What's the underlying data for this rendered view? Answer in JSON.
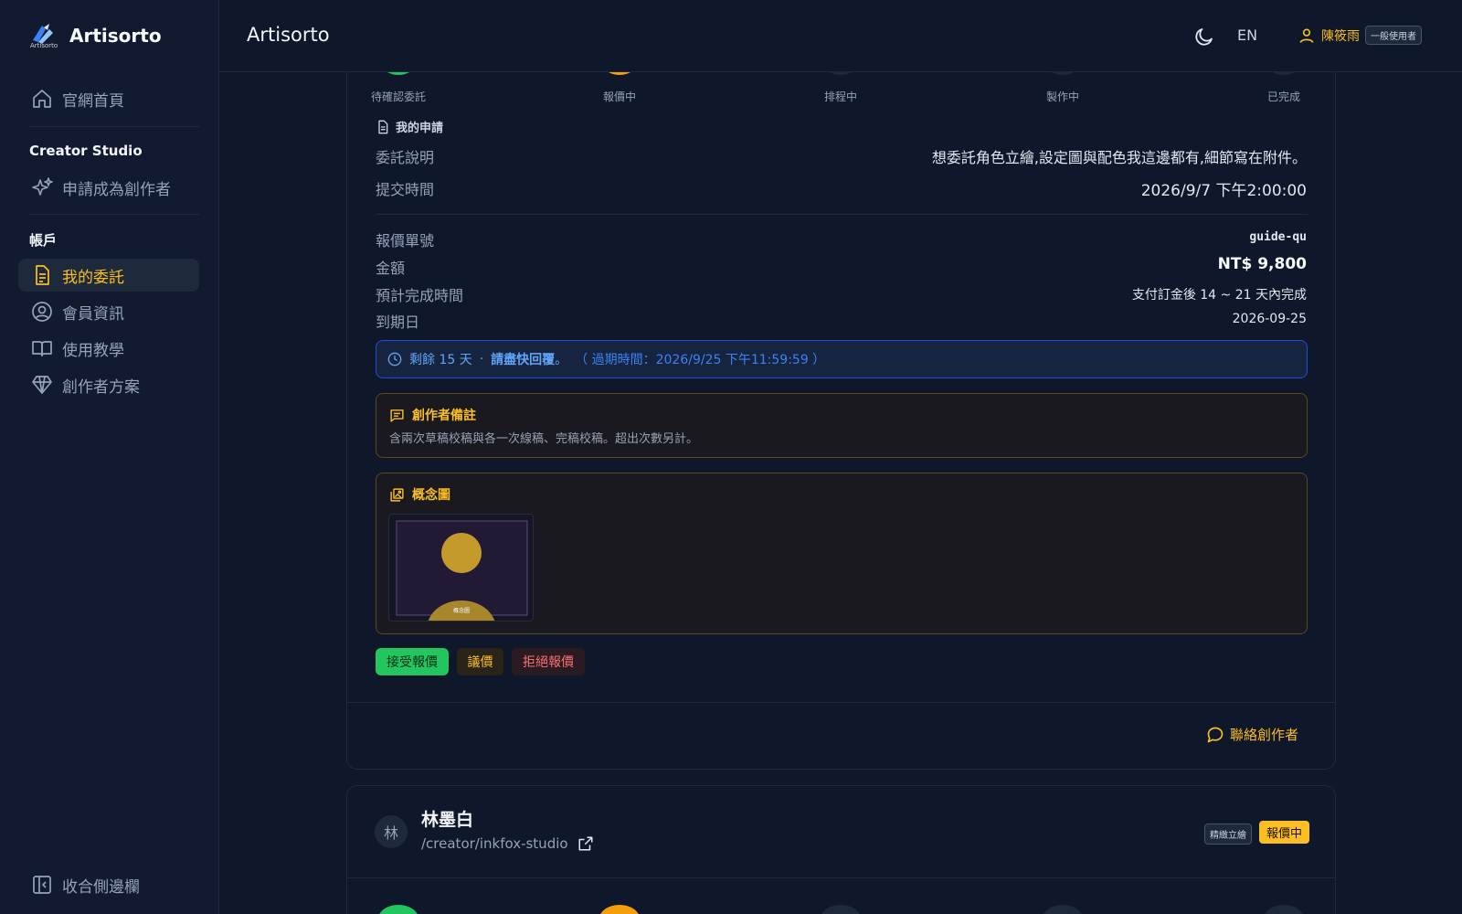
{
  "sidebar": {
    "logo_name": "Artisorto",
    "logo_sub": "Artisorto",
    "home": "官網首頁",
    "studio_title": "Creator Studio",
    "apply": "申請成為創作者",
    "account_title": "帳戶",
    "items": [
      {
        "label": "我的委託"
      },
      {
        "label": "會員資訊"
      },
      {
        "label": "使用教學"
      },
      {
        "label": "創作者方案"
      }
    ],
    "collapse": "收合側邊欄"
  },
  "header": {
    "title": "Artisorto",
    "lang": "EN",
    "user_name": "陳筱雨",
    "user_role": "一般使用者"
  },
  "steps": [
    "待確認委託",
    "報價中",
    "排程中",
    "製作中",
    "已完成"
  ],
  "request": {
    "heading": "我的申請",
    "desc_label": "委託說明",
    "desc_value": "想委託角色立繪,設定圖與配色我這邊都有,細節寫在附件。",
    "time_label": "提交時間",
    "time_value": "2026/9/7 下午2:00:00"
  },
  "quote": {
    "id_label": "報價單號",
    "id_value": "guide-qu",
    "amount_label": "金額",
    "amount_value": "NT$ 9,800",
    "eta_label": "預計完成時間",
    "eta_value": "支付訂金後 14 ~ 21 天內完成",
    "due_label": "到期日",
    "due_value": "2026-09-25"
  },
  "deadline": {
    "remaining": "剩餘 15 天",
    "sep": "·",
    "urge": "請盡快回覆",
    "tail": "。",
    "expiry": "（ 過期時間：2026/9/25 下午11:59:59 ）"
  },
  "note": {
    "heading": "創作者備註",
    "text": "含兩次草稿校稿與各一次線稿、完稿校稿。超出次數另計。"
  },
  "concept": {
    "heading": "概念圖",
    "thumb_label": "概念圖"
  },
  "actions": {
    "accept": "接受報價",
    "negotiate": "議價",
    "reject": "拒絕報價",
    "contact": "聯絡創作者"
  },
  "next_card": {
    "avatar": "林",
    "name": "林墨白",
    "link": "/creator/inkfox-studio",
    "type_tag": "精緻立繪",
    "status_tag": "報價中"
  },
  "colors": {
    "accent": "#fbbf24",
    "success": "#22c55e",
    "danger": "#f87171",
    "info": "#60a5fa",
    "background": "#0f172a"
  }
}
